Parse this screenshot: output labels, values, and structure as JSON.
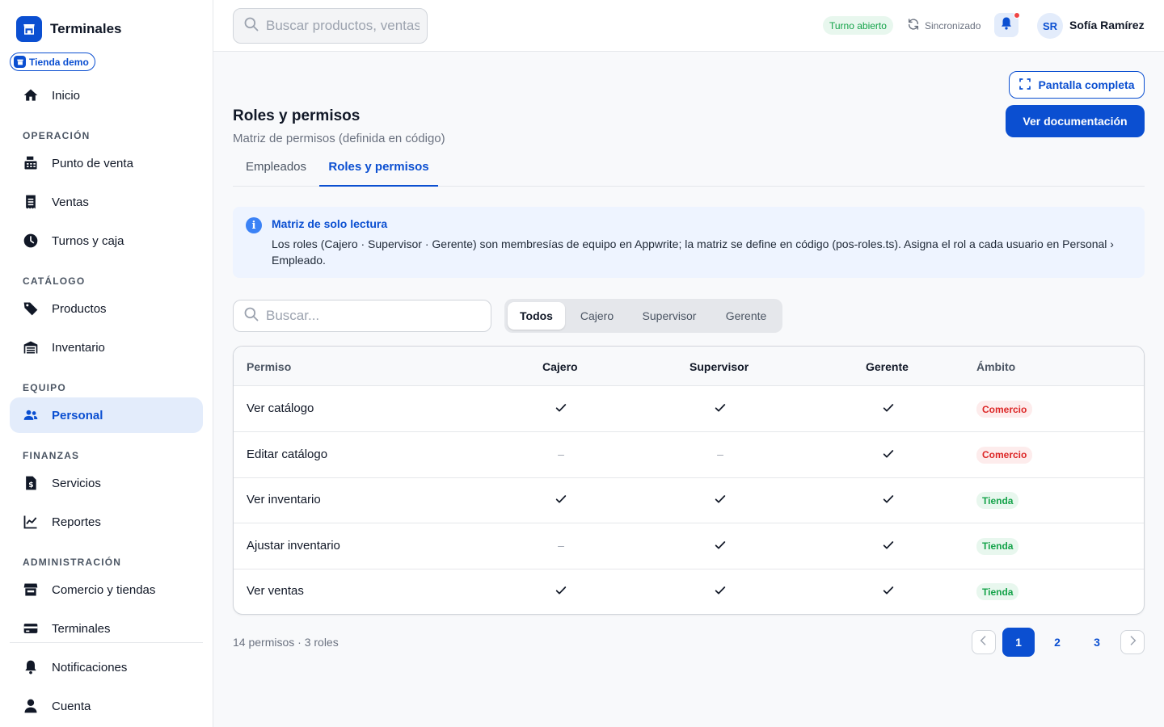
{
  "brand": {
    "title": "Terminales",
    "store": "Tienda demo"
  },
  "sidebar": {
    "home": "Inicio",
    "sections": {
      "operacion": "OPERACIÓN",
      "catalogo": "CATÁLOGO",
      "equipo": "EQUIPO",
      "finanzas": "FINANZAS",
      "administracion": "ADMINISTRACIÓN"
    },
    "items": {
      "pos": "Punto de venta",
      "ventas": "Ventas",
      "turnos": "Turnos y caja",
      "productos": "Productos",
      "inventario": "Inventario",
      "personal": "Personal",
      "servicios": "Servicios",
      "reportes": "Reportes",
      "comercio": "Comercio y tiendas",
      "terminales": "Terminales",
      "notificaciones": "Notificaciones",
      "cuenta": "Cuenta"
    }
  },
  "topbar": {
    "search_placeholder": "Buscar productos, ventas...",
    "shift_status": "Turno abierto",
    "sync_status": "Sincronizado",
    "user_initials": "SR",
    "user_name": "Sofía Ramírez"
  },
  "header": {
    "fullscreen_label": "Pantalla completa",
    "docs_label": "Ver documentación",
    "title": "Roles y permisos",
    "subtitle": "Matriz de permisos (definida en código)"
  },
  "tabs": [
    "Empleados",
    "Roles y permisos"
  ],
  "alert": {
    "title": "Matriz de solo lectura",
    "body": "Los roles (Cajero · Supervisor · Gerente) son membresías de equipo en Appwrite; la matriz se define en código (pos-roles.ts). Asigna el rol a cada usuario en Personal › Empleado."
  },
  "filters": {
    "search_placeholder": "Buscar...",
    "segments": [
      "Todos",
      "Cajero",
      "Supervisor",
      "Gerente"
    ]
  },
  "table": {
    "headers": {
      "permiso": "Permiso",
      "cajero": "Cajero",
      "supervisor": "Supervisor",
      "gerente": "Gerente",
      "ambito": "Ámbito"
    },
    "dash": "–",
    "rows": [
      {
        "name": "Ver catálogo",
        "cajero": true,
        "supervisor": true,
        "gerente": true,
        "scope": "Comercio"
      },
      {
        "name": "Editar catálogo",
        "cajero": false,
        "supervisor": false,
        "gerente": true,
        "scope": "Comercio"
      },
      {
        "name": "Ver inventario",
        "cajero": true,
        "supervisor": true,
        "gerente": true,
        "scope": "Tienda"
      },
      {
        "name": "Ajustar inventario",
        "cajero": false,
        "supervisor": true,
        "gerente": true,
        "scope": "Tienda"
      },
      {
        "name": "Ver ventas",
        "cajero": true,
        "supervisor": true,
        "gerente": true,
        "scope": "Tienda"
      }
    ]
  },
  "footer": {
    "count": "14 permisos · 3 roles",
    "pages": [
      "1",
      "2",
      "3"
    ],
    "current_page": "1"
  },
  "colors": {
    "primary": "#0b4fd1",
    "scope_comercio_text": "#dc2626",
    "scope_comercio_bg": "#fdecec",
    "scope_tienda_text": "#15a34a",
    "scope_tienda_bg": "#e8f7ee"
  }
}
